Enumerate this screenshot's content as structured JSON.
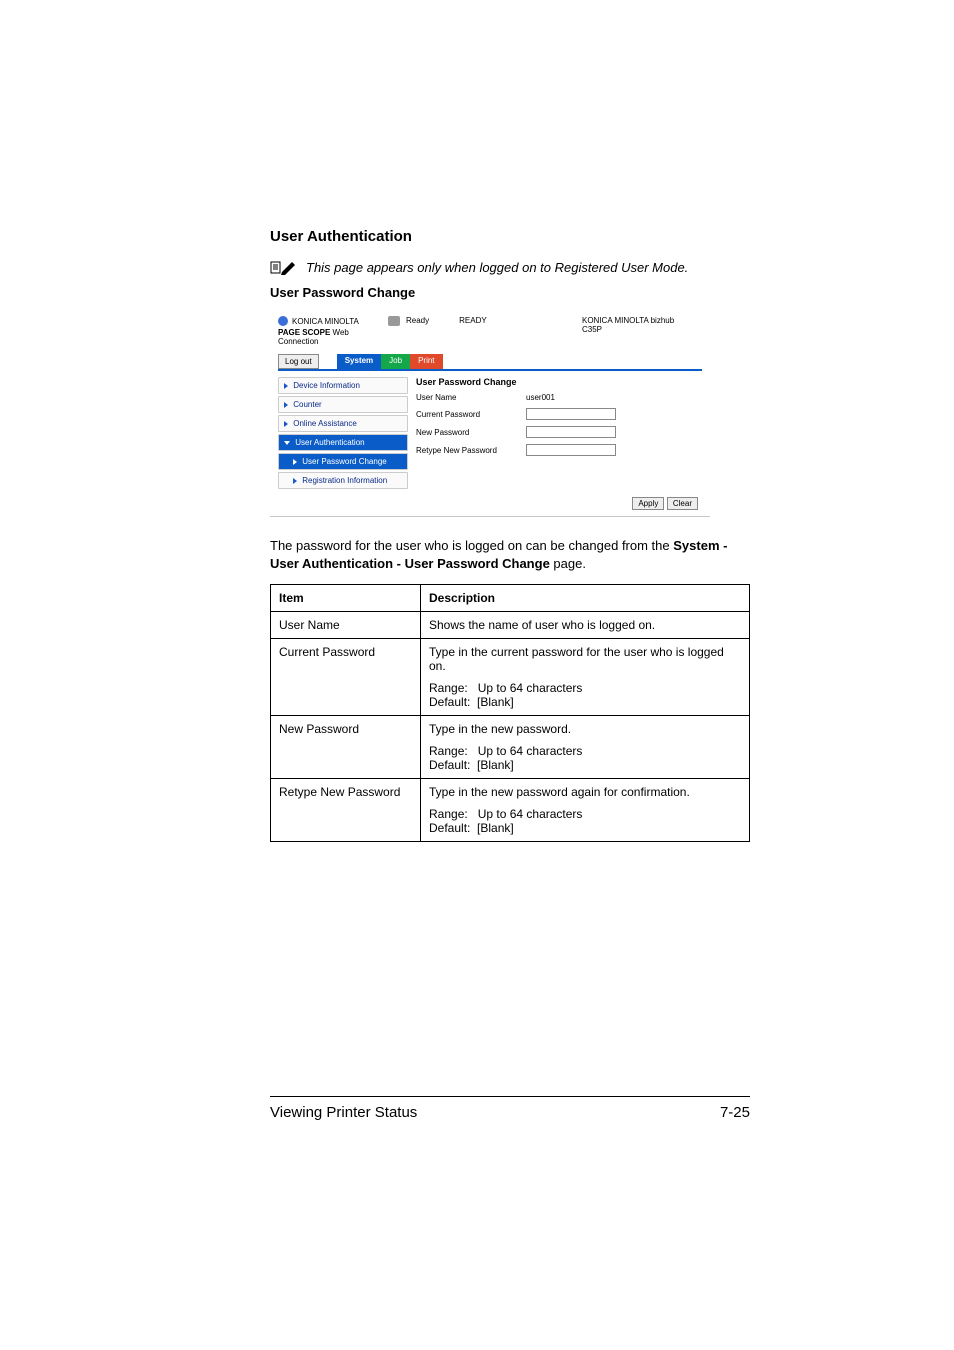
{
  "headings": {
    "user_auth": "User Authentication",
    "user_pw_change": "User Password Change"
  },
  "note": {
    "text": "This page appears only when logged on to Registered User Mode."
  },
  "shot": {
    "brand": "KONICA MINOLTA",
    "web_conn_prefix": "PAGE SCOPE",
    "web_conn": "Web Connection",
    "status_label": "Ready",
    "status_big": "READY",
    "device_line1": "KONICA MINOLTA bizhub",
    "device_line2": "C35P",
    "logout": "Log out",
    "tabs": {
      "system": "System",
      "job": "Job",
      "print": "Print"
    },
    "side": {
      "device_info": "Device Information",
      "counter": "Counter",
      "online_assist": "Online Assistance",
      "user_auth": "User Authentication",
      "user_pw_change": "User Password Change",
      "reg_info": "Registration Information"
    },
    "panel": {
      "title": "User Password Change",
      "user_name_lab": "User Name",
      "user_name_val": "user001",
      "curr_pw_lab": "Current Password",
      "new_pw_lab": "New Password",
      "retype_lab": "Retype New Password",
      "apply": "Apply",
      "clear": "Clear"
    }
  },
  "body": {
    "p1a": "The password for the user who is logged on can be changed from the ",
    "p1b": "System - User Authentication - User Password Change",
    "p1c": " page."
  },
  "table": {
    "h_item": "Item",
    "h_desc": "Description",
    "r1_item": "User Name",
    "r1_desc": "Shows the name of user who is logged on.",
    "r2_item": "Current Password",
    "r2_l1": "Type in the current password for the user who is logged on.",
    "r2_l2": "Range:   Up to 64 characters",
    "r2_l3": "Default:  [Blank]",
    "r3_item": "New Password",
    "r3_l1": "Type in the new password.",
    "r3_l2": "Range:   Up to 64 characters",
    "r3_l3": "Default:  [Blank]",
    "r4_item": "Retype New Password",
    "r4_l1": "Type in the new password again for confirmation.",
    "r4_l2": "Range:   Up to 64 characters",
    "r4_l3": "Default:  [Blank]"
  },
  "footer": {
    "left": "Viewing Printer Status",
    "right": "7-25"
  }
}
